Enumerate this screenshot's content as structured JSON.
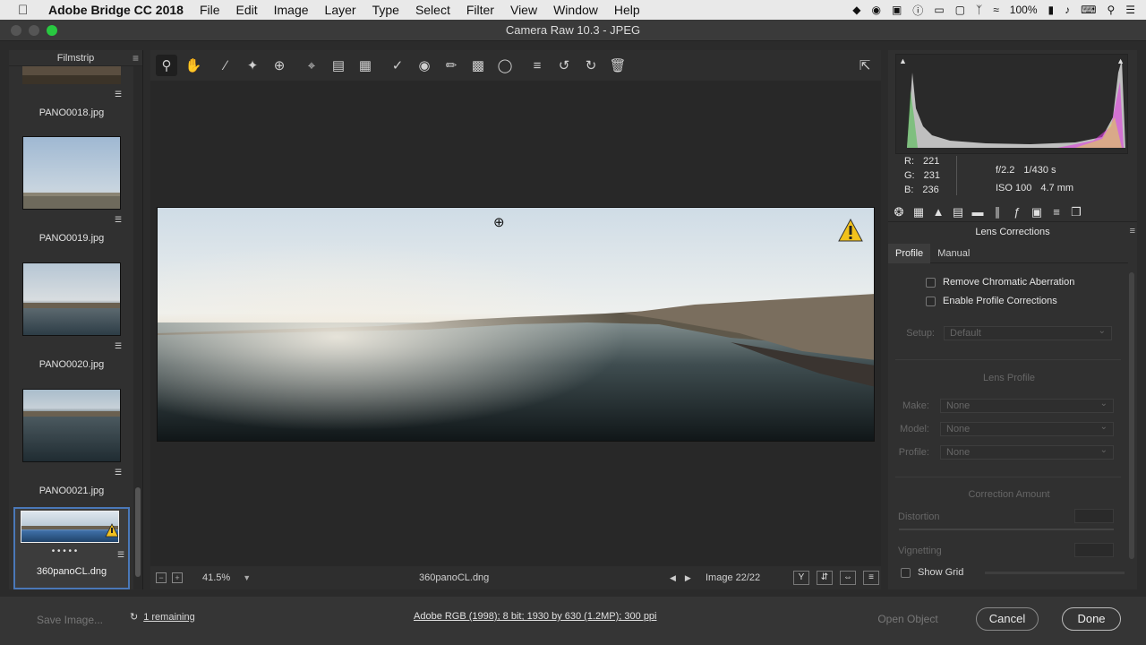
{
  "menubar": {
    "app_name": "Adobe Bridge CC 2018",
    "items": [
      "File",
      "Edit",
      "Image",
      "Layer",
      "Type",
      "Select",
      "Filter",
      "View",
      "Window",
      "Help"
    ],
    "battery": "100%"
  },
  "window": {
    "title": "Camera Raw 10.3  -  JPEG"
  },
  "filmstrip": {
    "header": "Filmstrip",
    "items": [
      {
        "label": "PANO0018.jpg"
      },
      {
        "label": "PANO0019.jpg"
      },
      {
        "label": "PANO0020.jpg"
      },
      {
        "label": "PANO0021.jpg"
      },
      {
        "label": "360panoCL.dng",
        "selected": true,
        "rating_dots": "• • • • •"
      }
    ]
  },
  "toolbar": {
    "tools": [
      "zoom-tool-icon",
      "hand-tool-icon",
      "white-balance-icon",
      "color-sampler-icon",
      "target-adjustment-icon",
      "crop-icon",
      "straighten-icon",
      "transform-icon",
      "spot-removal-icon",
      "red-eye-icon",
      "adjustment-brush-icon",
      "graduated-filter-icon",
      "radial-filter-icon",
      "preferences-icon",
      "rotate-ccw-icon",
      "rotate-cw-icon",
      "trash-icon"
    ]
  },
  "preview_bar": {
    "zoom": "41.5%",
    "filename": "360panoCL.dng",
    "counter": "Image 22/22",
    "view_mode": "Y"
  },
  "readout": {
    "r_label": "R:",
    "r_value": "221",
    "g_label": "G:",
    "g_value": "231",
    "b_label": "B:",
    "b_value": "236",
    "aperture": "f/2.2",
    "shutter": "1/430 s",
    "iso": "ISO 100",
    "focal": "4.7 mm"
  },
  "panel": {
    "title": "Lens Corrections",
    "sub_tabs": [
      "Profile",
      "Manual"
    ],
    "remove_ca": "Remove Chromatic Aberration",
    "enable_profile": "Enable Profile Corrections",
    "setup_label": "Setup:",
    "setup_value": "Default",
    "lens_profile_head": "Lens Profile",
    "make_label": "Make:",
    "make_value": "None",
    "model_label": "Model:",
    "model_value": "None",
    "profile_label": "Profile:",
    "profile_value": "None",
    "correction_head": "Correction Amount",
    "distortion_label": "Distortion",
    "vignetting_label": "Vignetting",
    "show_grid": "Show Grid"
  },
  "bottom": {
    "save_label": "Save Image...",
    "remaining_label": "1 remaining",
    "workflow_label": "Adobe RGB (1998); 8 bit; 1930 by 630 (1.2MP); 300 ppi",
    "open_label": "Open Object",
    "cancel_label": "Cancel",
    "done_label": "Done"
  }
}
